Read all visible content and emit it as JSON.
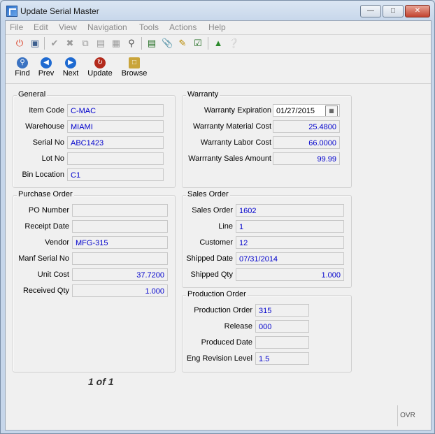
{
  "window": {
    "title": "Update Serial Master"
  },
  "menu": [
    "File",
    "Edit",
    "View",
    "Navigation",
    "Tools",
    "Actions",
    "Help"
  ],
  "toolbar_nav": {
    "find": "Find",
    "prev": "Prev",
    "next": "Next",
    "update": "Update",
    "browse": "Browse"
  },
  "general": {
    "legend": "General",
    "item_code_label": "Item Code",
    "item_code": "C-MAC",
    "warehouse_label": "Warehouse",
    "warehouse": "MIAMI",
    "serial_no_label": "Serial No",
    "serial_no": "ABC1423",
    "lot_no_label": "Lot No",
    "lot_no": "",
    "bin_location_label": "Bin Location",
    "bin_location": "C1"
  },
  "warranty": {
    "legend": "Warranty",
    "expiration_label": "Warranty Expiration",
    "expiration": "01/27/2015",
    "material_cost_label": "Warranty Material Cost",
    "material_cost": "25.4800",
    "labor_cost_label": "Warranty Labor Cost",
    "labor_cost": "66.0000",
    "sales_amount_label": "Warrranty Sales Amount",
    "sales_amount": "99.99"
  },
  "purchase_order": {
    "legend": "Purchase Order",
    "po_number_label": "PO Number",
    "po_number": "",
    "receipt_date_label": "Receipt Date",
    "receipt_date": "",
    "vendor_label": "Vendor",
    "vendor": "MFG-315",
    "manf_serial_label": "Manf Serial No",
    "manf_serial": "",
    "unit_cost_label": "Unit Cost",
    "unit_cost": "37.7200",
    "received_qty_label": "Received Qty",
    "received_qty": "1.000"
  },
  "sales_order": {
    "legend": "Sales Order",
    "sales_order_label": "Sales Order",
    "sales_order": "1602",
    "line_label": "Line",
    "line": "1",
    "customer_label": "Customer",
    "customer": "12",
    "shipped_date_label": "Shipped Date",
    "shipped_date": "07/31/2014",
    "shipped_qty_label": "Shipped Qty",
    "shipped_qty": "1.000"
  },
  "production_order": {
    "legend": "Production Order",
    "production_order_label": "Production Order",
    "production_order": "315",
    "release_label": "Release",
    "release": "000",
    "produced_date_label": "Produced Date",
    "produced_date": "",
    "eng_revision_label": "Eng Revision Level",
    "eng_revision": "1.5"
  },
  "record_nav": "1 of 1",
  "status": {
    "ovr": "OVR"
  }
}
